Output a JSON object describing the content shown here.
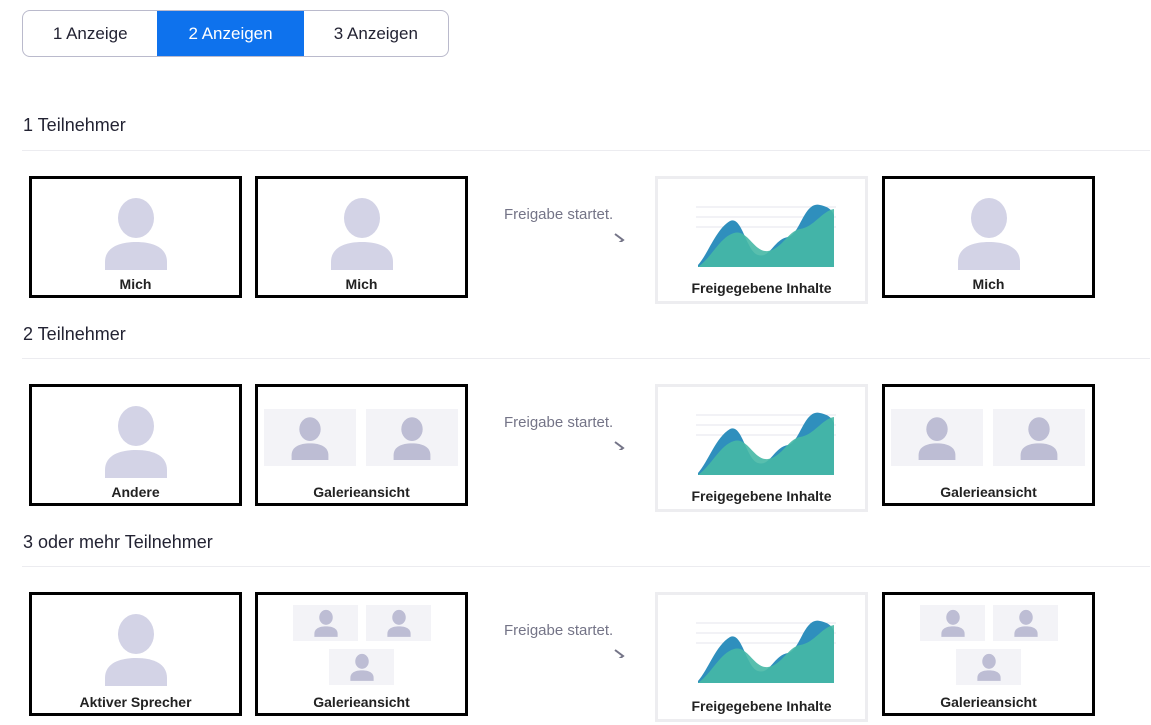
{
  "tabs": [
    {
      "label": "1 Anzeige",
      "active": false
    },
    {
      "label": "2 Anzeigen",
      "active": true
    },
    {
      "label": "3 Anzeigen",
      "active": false
    }
  ],
  "accent_color": "#0e72ed",
  "arrow_text": "Freigabe startet.",
  "sections": [
    {
      "title": "1 Teilnehmer",
      "before_left": "Mich",
      "before_right": "Mich",
      "after_left": "Freigegebene Inhalte",
      "after_right": "Mich"
    },
    {
      "title": "2 Teilnehmer",
      "before_left": "Andere",
      "before_right": "Galerieansicht",
      "after_left": "Freigegebene Inhalte",
      "after_right": "Galerieansicht"
    },
    {
      "title": "3 oder mehr Teilnehmer",
      "before_left": "Aktiver Sprecher",
      "before_right": "Galerieansicht",
      "after_left": "Freigegebene Inhalte",
      "after_right": "Galerieansicht"
    }
  ],
  "icons": {
    "avatar": "person-avatar-icon",
    "chart": "shared-content-chart-icon",
    "arrow": "arrow-right-icon"
  }
}
